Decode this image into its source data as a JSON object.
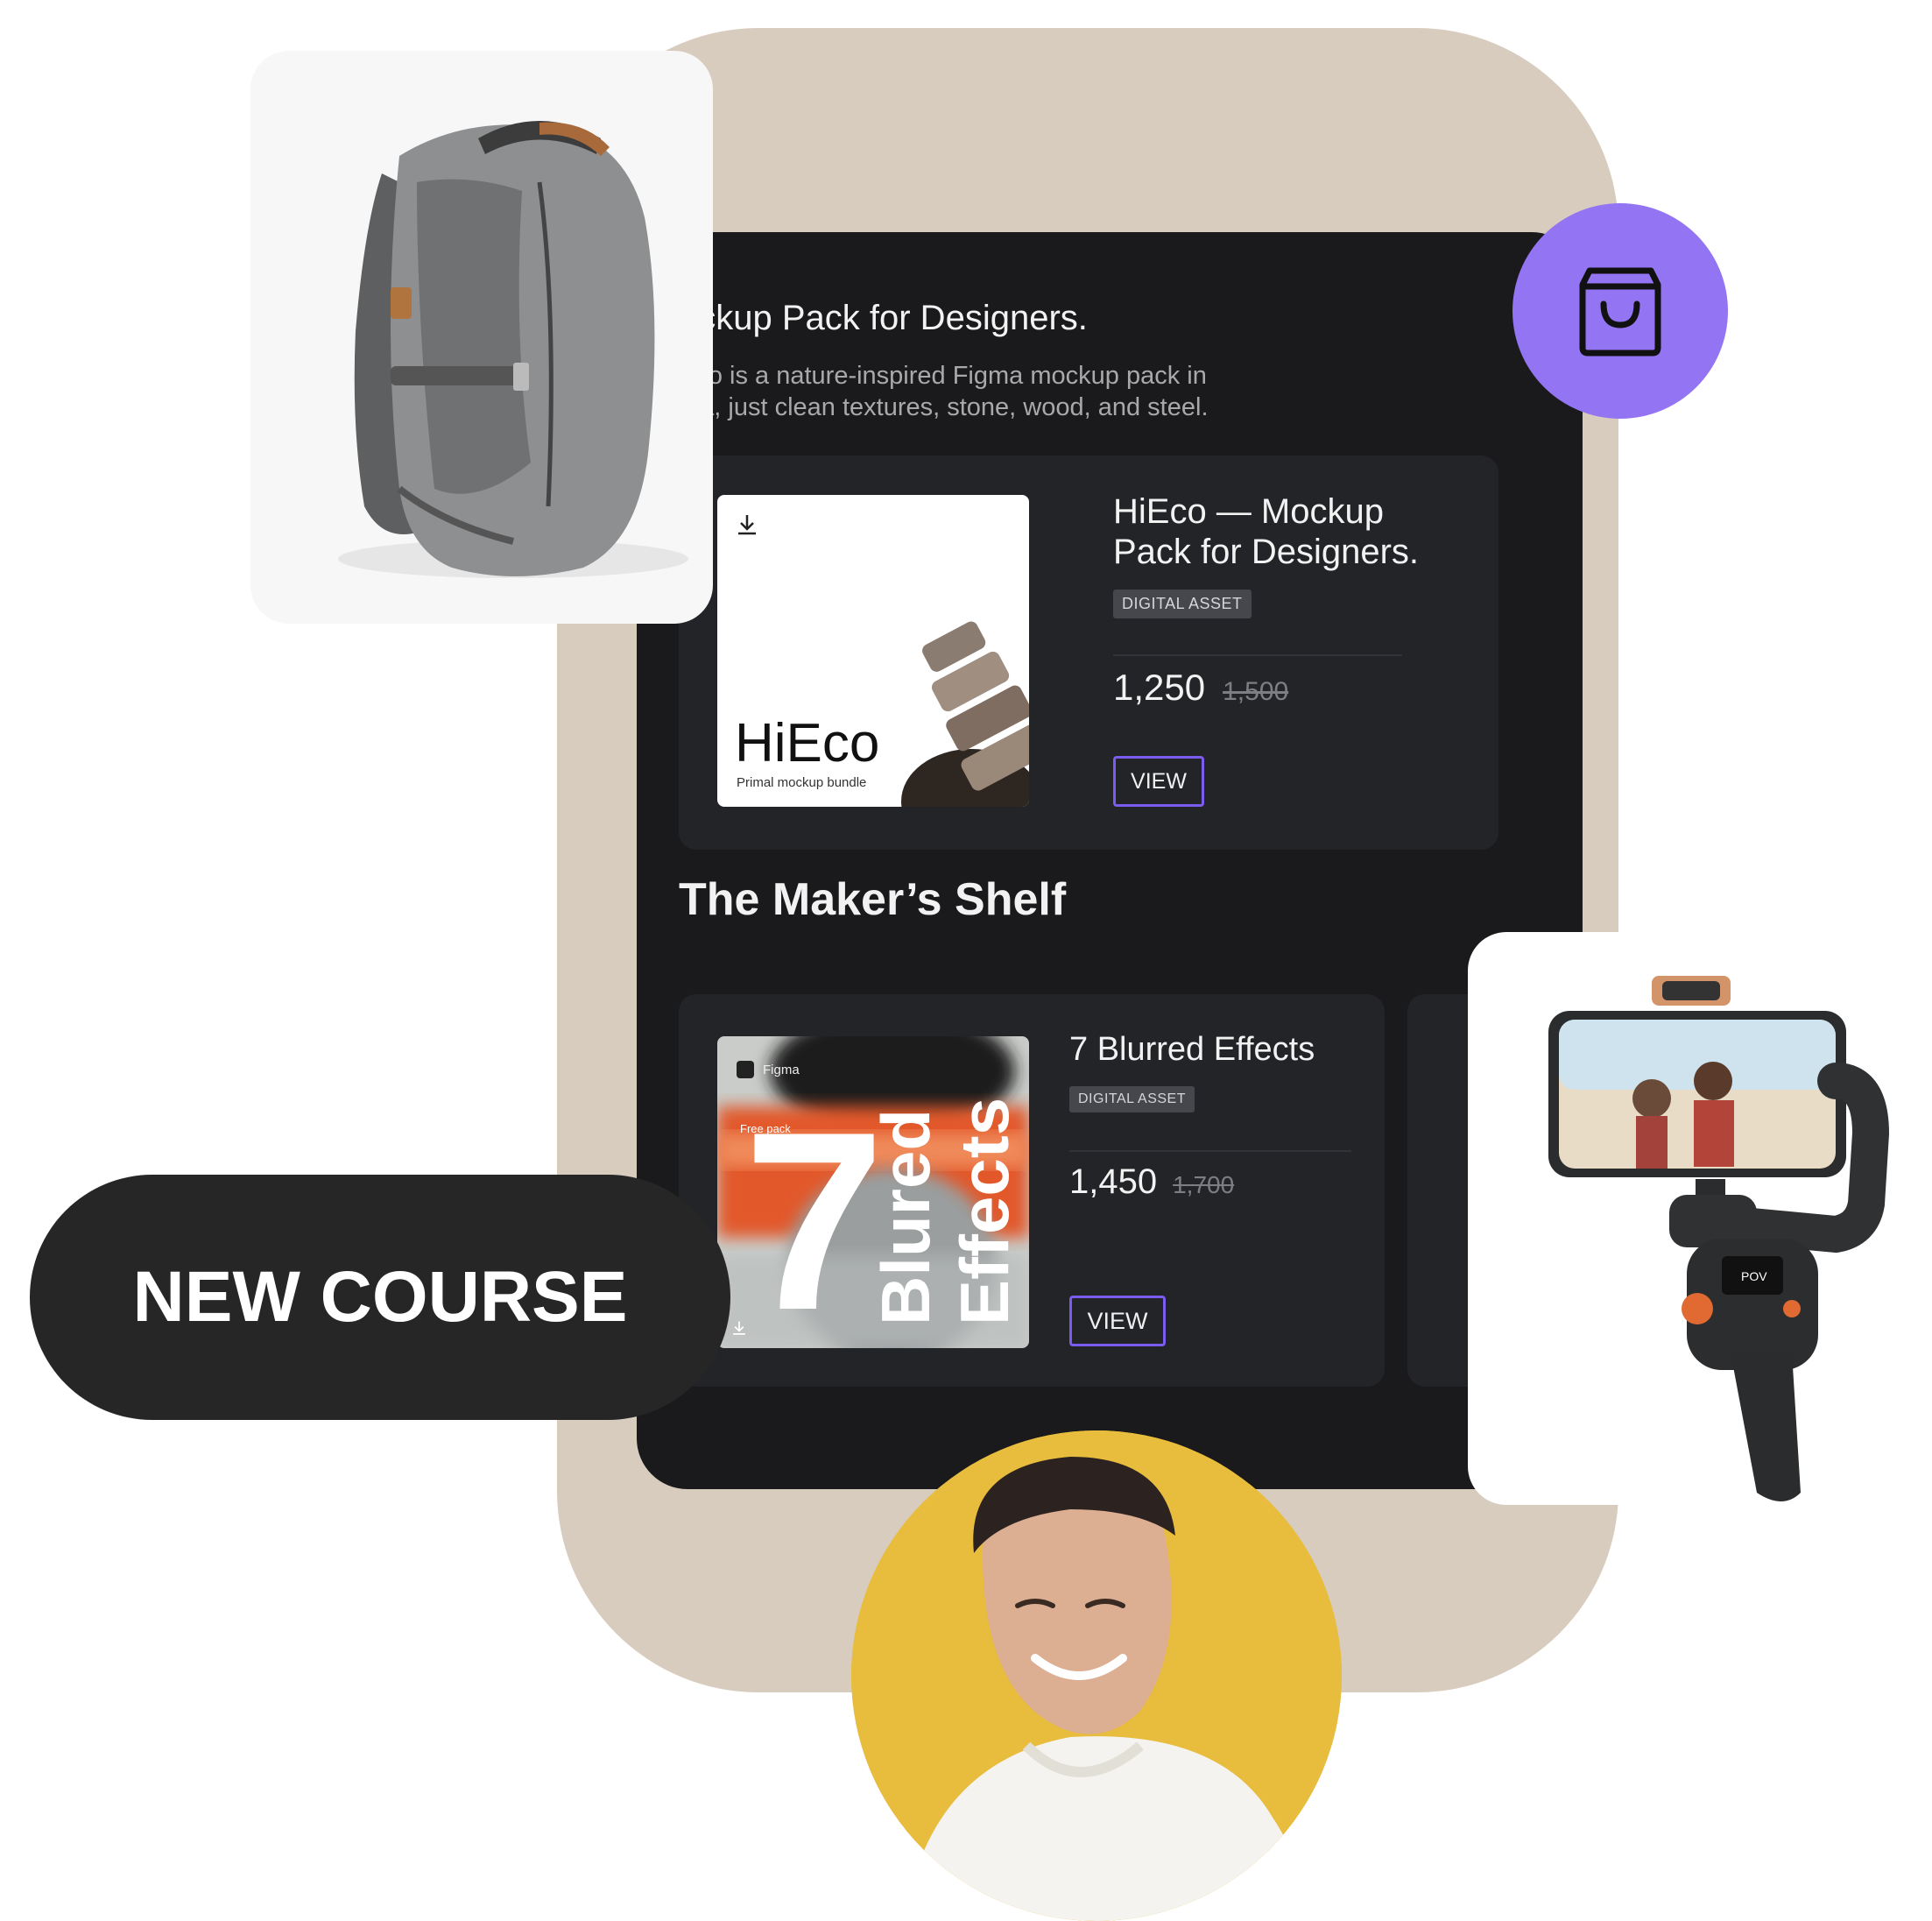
{
  "screen": {
    "title": "ockup Pack for Designers.",
    "description": "Eco is a nature-inspired Figma mockup pack in\nma, just clean textures, stone, wood, and steel."
  },
  "featured_product": {
    "title_line1": "HiEco — Mockup",
    "title_line2": "Pack for Designers.",
    "tag": "DIGITAL ASSET",
    "price": "1,250",
    "old_price": "1,500",
    "view_label": "VIEW",
    "thumbnail": {
      "brand": "HiEco",
      "subtitle": "Primal mockup bundle",
      "icon": "download-icon"
    }
  },
  "shelf": {
    "title": "The Maker’s Shelf",
    "products": [
      {
        "title": "7 Blurred Effects",
        "tag": "DIGITAL ASSET",
        "price": "1,450",
        "old_price": "1,700",
        "view_label": "VIEW",
        "thumbnail": {
          "app": "Figma",
          "badge": "Free pack",
          "number": "7",
          "word1": "Blured",
          "word2": "Effects"
        }
      }
    ]
  },
  "floating": {
    "new_course_label": "NEW COURSE",
    "cart_icon": "shopping-bag-icon"
  },
  "gimbal_screen": {
    "mode": "POV"
  },
  "colors": {
    "backdrop": "#d8ccbf",
    "screen": "#1a1a1c",
    "card": "#232427",
    "accent": "#7b5cf0",
    "cart_circle": "#9374f2",
    "person_bg": "#e8bc3c",
    "badge_dark": "#262626"
  }
}
